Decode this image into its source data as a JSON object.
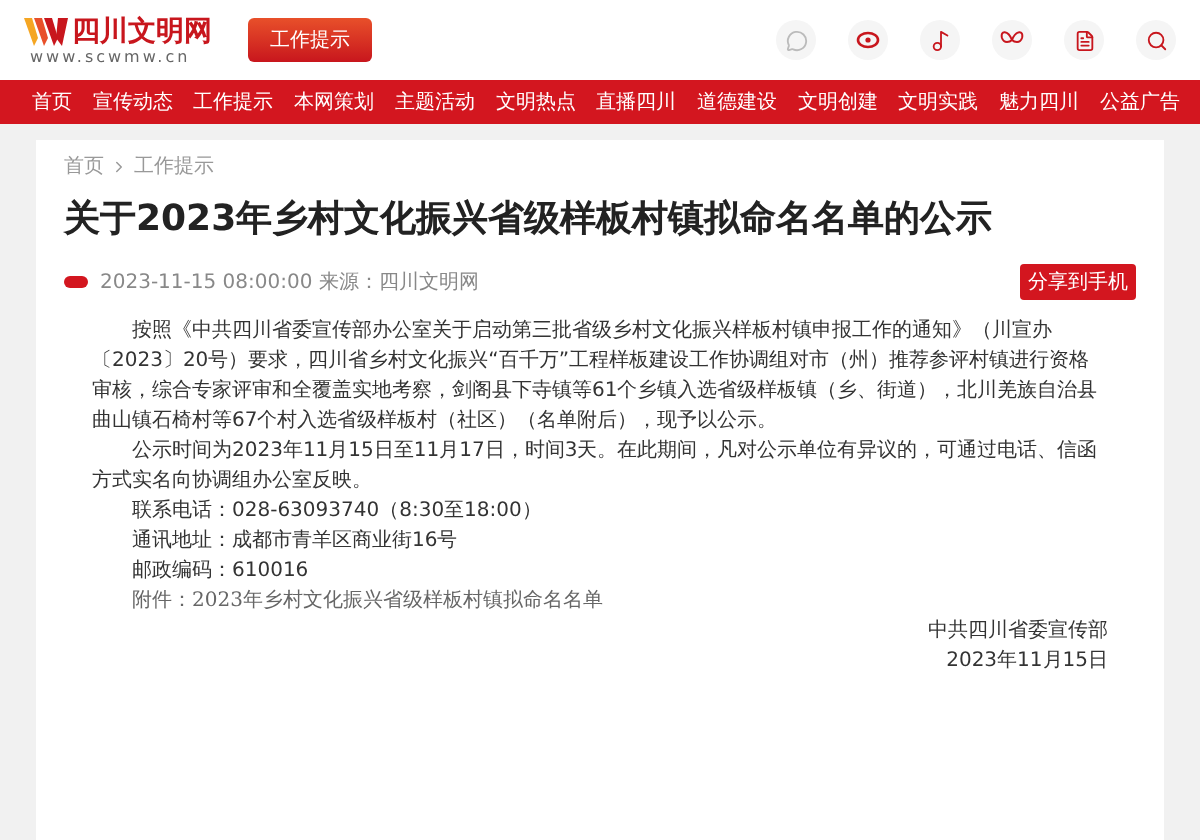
{
  "header": {
    "site_name": "四川文明网",
    "site_url": "www.scwmw.cn",
    "section_badge": "工作提示"
  },
  "nav": [
    "首页",
    "宣传动态",
    "工作提示",
    "本网策划",
    "主题活动",
    "文明热点",
    "直播四川",
    "道德建设",
    "文明创建",
    "文明实践",
    "魅力四川",
    "公益广告"
  ],
  "breadcrumb": [
    "首页",
    "工作提示"
  ],
  "article": {
    "title": "关于2023年乡村文化振兴省级样板村镇拟命名名单的公示",
    "meta": "2023-11-15 08:00:00 来源：四川文明网",
    "share_button": "分享到手机",
    "body": [
      {
        "kind": "paragraph",
        "text": "按照《中共四川省委宣传部办公室关于启动第三批省级乡村文化振兴样板村镇申报工作的通知》（川宣办〔2023〕20号）要求，四川省乡村文化振兴“百千万”工程样板建设工作协调组对市（州）推荐参评村镇进行资格审核，综合专家评审和全覆盖实地考察，剑阁县下寺镇等61个乡镇入选省级样板镇（乡、街道），北川羌族自治县曲山镇石椅村等67个村入选省级样板村（社区）（名单附后），现予以公示。"
      },
      {
        "kind": "paragraph",
        "text": "公示时间为2023年11月15日至11月17日，时间3天。在此期间，凡对公示单位有异议的，可通过电话、信函方式实名向协调组办公室反映。"
      },
      {
        "kind": "line",
        "text": "联系电话：028-63093740（8:30至18:00）"
      },
      {
        "kind": "line",
        "text": "通讯地址：成都市青羊区商业街16号"
      },
      {
        "kind": "line",
        "text": "邮政编码：610016"
      },
      {
        "kind": "attachment",
        "text": "附件：2023年乡村文化振兴省级样板村镇拟命名名单"
      }
    ],
    "signature": [
      "中共四川省委宣传部",
      "2023年11月15日"
    ]
  }
}
